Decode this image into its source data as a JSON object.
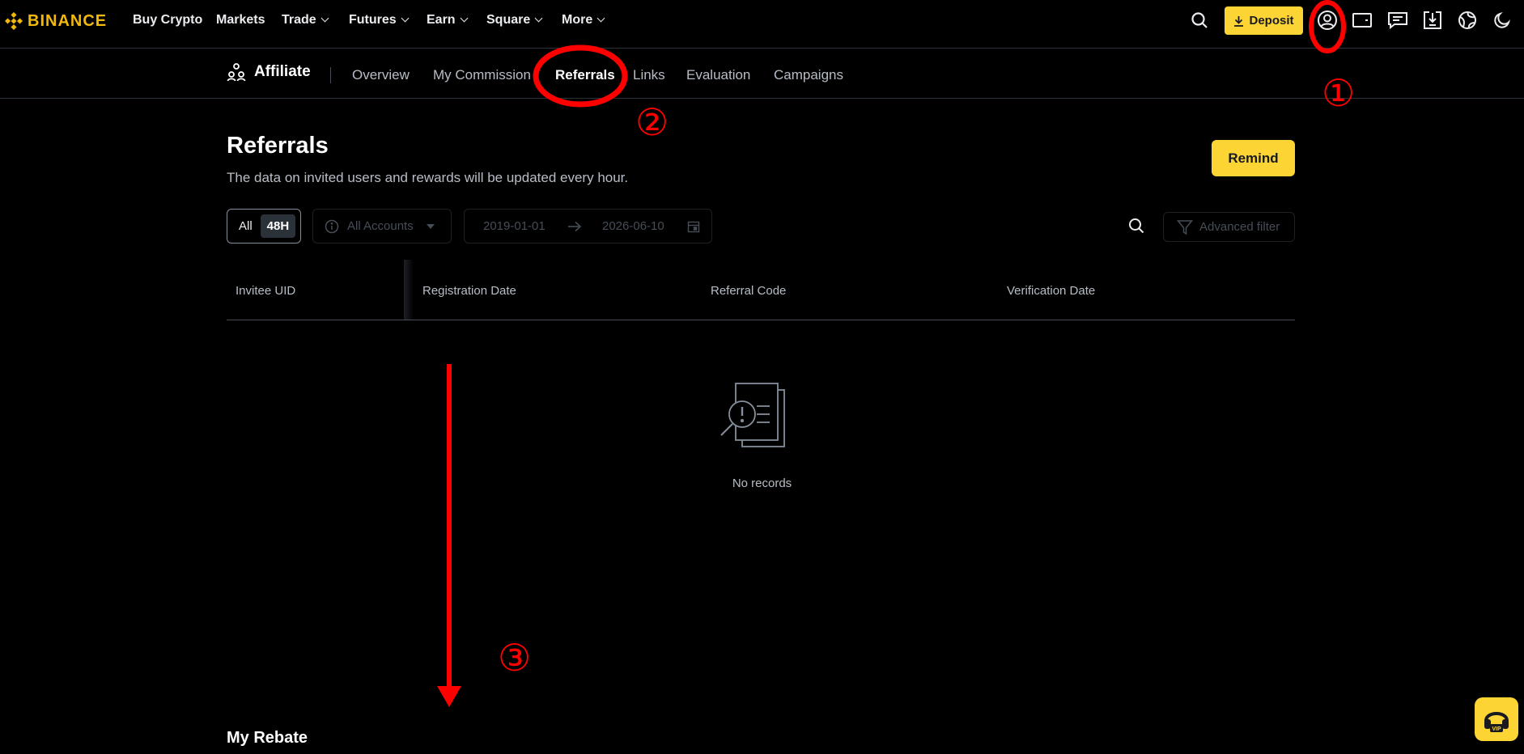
{
  "brand": {
    "name": "BINANCE",
    "color": "#f0b90b"
  },
  "topnav": {
    "items": [
      {
        "label": "Buy Crypto",
        "has_dropdown": false
      },
      {
        "label": "Markets",
        "has_dropdown": false
      },
      {
        "label": "Trade",
        "has_dropdown": true
      },
      {
        "label": "Futures",
        "has_dropdown": true
      },
      {
        "label": "Earn",
        "has_dropdown": true
      },
      {
        "label": "Square",
        "has_dropdown": true
      },
      {
        "label": "More",
        "has_dropdown": true
      }
    ],
    "deposit_label": "Deposit",
    "icons": [
      "search-icon",
      "download-icon",
      "account-icon",
      "wallet-icon",
      "message-icon",
      "app-download-icon",
      "globe-icon",
      "moon-icon"
    ]
  },
  "subnav": {
    "title": "Affiliate",
    "tabs": [
      {
        "label": "Overview",
        "active": false
      },
      {
        "label": "My Commission",
        "active": false
      },
      {
        "label": "Referrals",
        "active": true
      },
      {
        "label": "Links",
        "active": false
      },
      {
        "label": "Evaluation",
        "active": false
      },
      {
        "label": "Campaigns",
        "active": false
      }
    ]
  },
  "main": {
    "title": "Referrals",
    "description": "The data on invited users and rewards will be updated every hour.",
    "remind_label": "Remind",
    "filters": {
      "all_label": "All",
      "period_label": "48H",
      "accounts_label": "All Accounts",
      "date_start": "2019-01-01",
      "date_end": "2026-06-10",
      "advanced_filter_label": "Advanced filter"
    },
    "table": {
      "columns": [
        "Invitee UID",
        "Registration Date",
        "Referral Code",
        "Verification Date"
      ],
      "rows": [],
      "empty_text": "No records"
    },
    "rebate_title": "My Rebate"
  },
  "annotations": {
    "color": "#ff0000",
    "labels": [
      "①",
      "②",
      "③"
    ]
  },
  "colors": {
    "accent": "#fcd535",
    "background": "#000000",
    "text_primary": "#eaecef",
    "text_secondary": "#b7bdc6"
  }
}
